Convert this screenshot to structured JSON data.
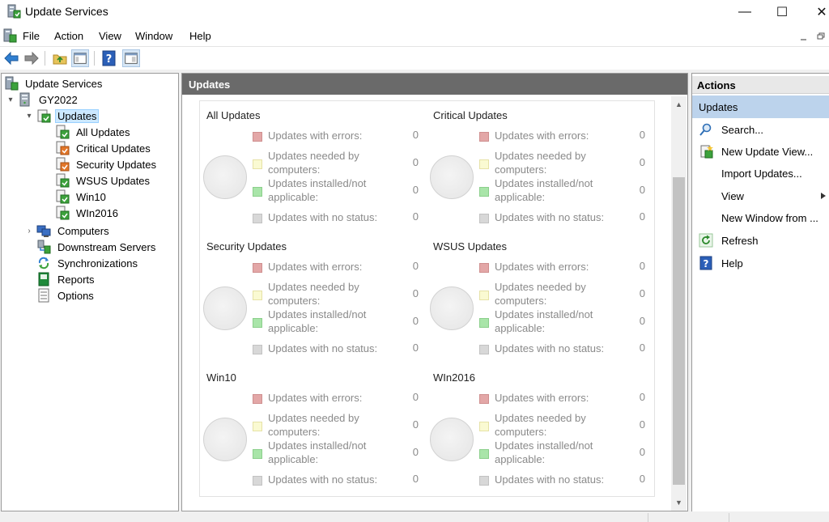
{
  "window": {
    "title": "Update Services",
    "minimize_glyph": "—",
    "maximize_glyph": "☐",
    "close_glyph": "✕"
  },
  "menu": {
    "items": [
      "File",
      "Action",
      "View",
      "Window",
      "Help"
    ]
  },
  "tree": {
    "root": "Update Services",
    "server": "GY2022",
    "updates": "Updates",
    "update_views": [
      "All Updates",
      "Critical Updates",
      "Security Updates",
      "WSUS Updates",
      "Win10",
      "WIn2016"
    ],
    "computers": "Computers",
    "downstream": "Downstream Servers",
    "synchronizations": "Synchronizations",
    "reports": "Reports",
    "options": "Options"
  },
  "center": {
    "header": "Updates",
    "legend_labels": {
      "errors": "Updates with errors:",
      "needed": "Updates needed by computers:",
      "installed": "Updates installed/not applicable:",
      "no_status": "Updates with no status:"
    },
    "groups": [
      {
        "title": "All Updates",
        "errors": "0",
        "needed": "0",
        "installed": "0",
        "no_status": "0"
      },
      {
        "title": "Critical Updates",
        "errors": "0",
        "needed": "0",
        "installed": "0",
        "no_status": "0"
      },
      {
        "title": "Security Updates",
        "errors": "0",
        "needed": "0",
        "installed": "0",
        "no_status": "0"
      },
      {
        "title": "WSUS Updates",
        "errors": "0",
        "needed": "0",
        "installed": "0",
        "no_status": "0"
      },
      {
        "title": "Win10",
        "errors": "0",
        "needed": "0",
        "installed": "0",
        "no_status": "0"
      },
      {
        "title": "WIn2016",
        "errors": "0",
        "needed": "0",
        "installed": "0",
        "no_status": "0"
      }
    ]
  },
  "actions": {
    "header": "Actions",
    "section": "Updates",
    "items": {
      "search": "Search...",
      "new_view": "New Update View...",
      "import": "Import Updates...",
      "view": "View",
      "new_window": "New Window from ...",
      "refresh": "Refresh",
      "help": "Help"
    }
  },
  "colors": {
    "header_bg": "#6a6a6a",
    "selection_bg": "#cce8ff",
    "actions_section_bg": "#bcd3ec",
    "errors": "#e3a7a7",
    "needed": "#fafad2",
    "installed": "#a9e5a9",
    "no_status": "#d8d8d8"
  },
  "icons": {
    "window": "wsus-server-icon",
    "toolbar": [
      "back-arrow-icon",
      "forward-arrow-icon",
      "up-folder-icon",
      "show-hide-tree-icon",
      "help-icon",
      "show-hide-action-pane-icon"
    ]
  }
}
